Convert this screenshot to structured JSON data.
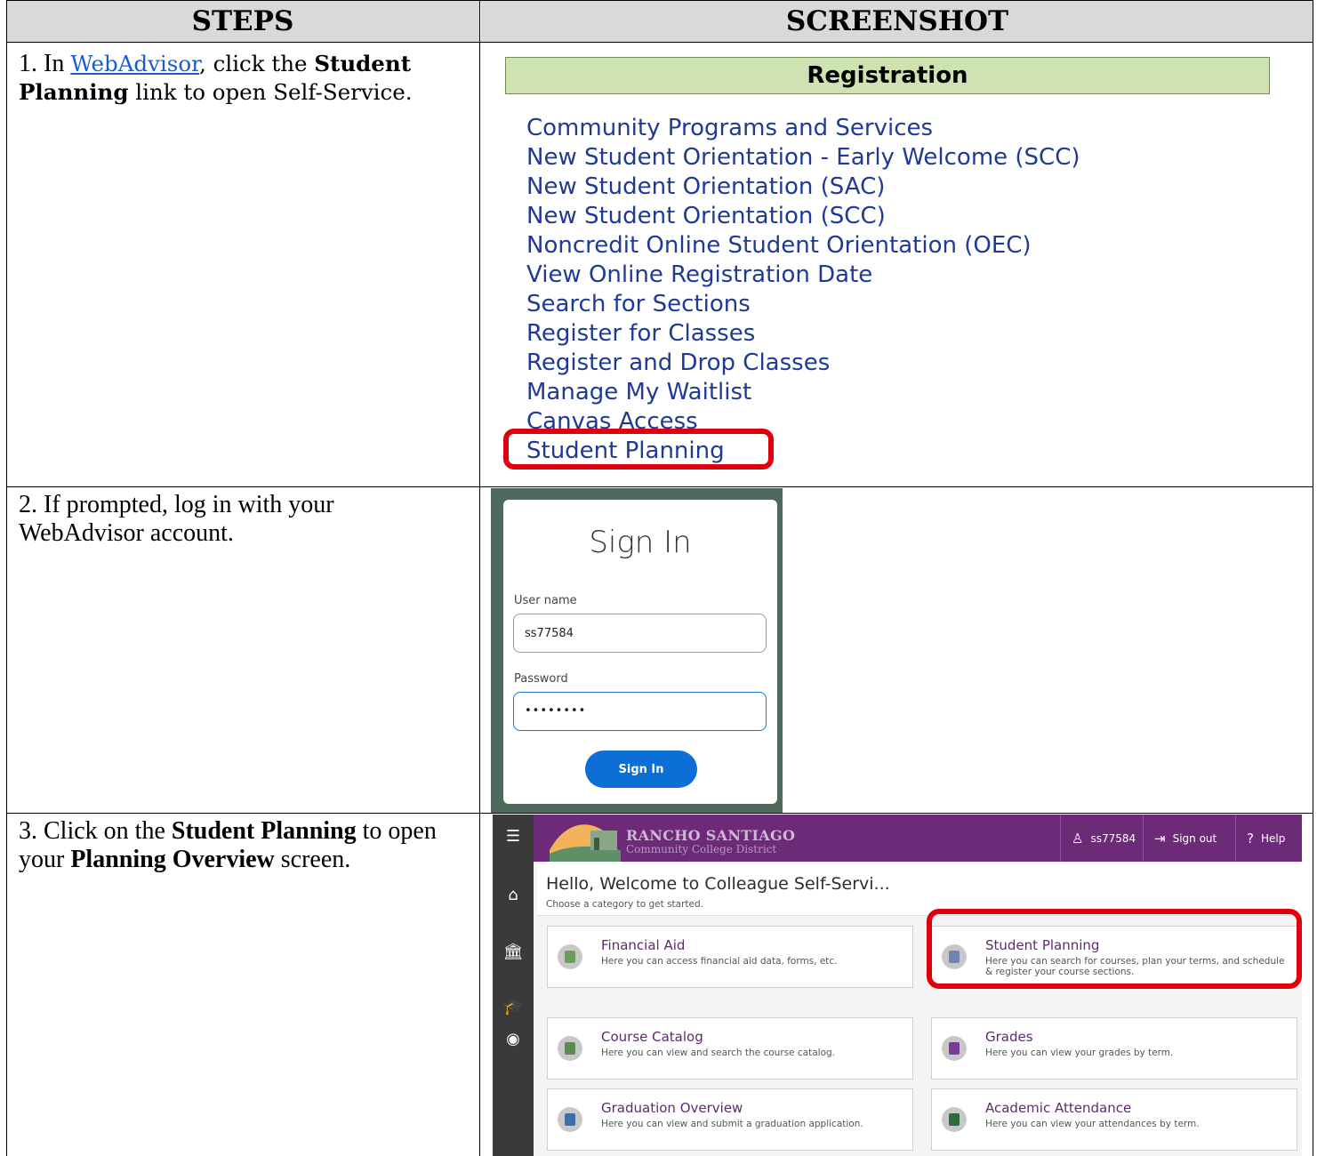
{
  "table": {
    "header_steps": "STEPS",
    "header_screenshot": "SCREENSHOT"
  },
  "steps": {
    "s1": {
      "prefix": "1.  In ",
      "link": "WebAdvisor",
      "mid": ", click the ",
      "bold": "Student Planning",
      "suffix": " link to open Self-Service."
    },
    "s2": {
      "text": "2.  If prompted, log in with your WebAdvisor account."
    },
    "s3": {
      "prefix": "3.  Click on the ",
      "bold1": "Student Planning",
      "mid": " to open your ",
      "bold2": "Planning Overview",
      "suffix": " screen."
    }
  },
  "registration": {
    "heading": "Registration",
    "items": [
      "Community Programs and Services",
      "New Student Orientation - Early Welcome (SCC)",
      "New Student Orientation (SAC)",
      "New Student Orientation (SCC)",
      "Noncredit Online Student Orientation (OEC)",
      "View Online Registration Date",
      "Search for Sections",
      "Register for Classes",
      "Register and Drop Classes",
      "Manage My Waitlist"
    ],
    "partial_item": "Canvas Access",
    "highlighted_item": "Student Planning",
    "highlight_color": "#e0000d",
    "link_color": "#1e3a96"
  },
  "signin": {
    "title": "Sign In",
    "username_label": "User name",
    "username_value": "ss77584",
    "password_label": "Password",
    "password_value": "••••••••",
    "button_label": "Sign In",
    "button_color": "#0b6fd6"
  },
  "selfservice": {
    "brand_name": "RANCHO SANTIAGO",
    "brand_sub": "Community College District",
    "user": "ss77584",
    "signout": "Sign out",
    "help": "Help",
    "welcome": "Hello, Welcome to Colleague Self-Servi...",
    "choose": "Choose a category to get started.",
    "header_color": "#6c2a78",
    "cards": [
      {
        "title": "Financial Aid",
        "desc": "Here you can access financial aid data, forms, etc.",
        "icon": "money-icon"
      },
      {
        "title": "Student Planning",
        "desc": "Here you can search for courses, plan your terms, and schedule & register your course sections.",
        "icon": "planning-icon"
      },
      {
        "title": "Course Catalog",
        "desc": "Here you can view and search the course catalog.",
        "icon": "book-icon"
      },
      {
        "title": "Grades",
        "desc": "Here you can view your grades by term.",
        "icon": "grades-icon"
      },
      {
        "title": "Graduation Overview",
        "desc": "Here you can view and submit a graduation application.",
        "icon": "graduation-icon"
      },
      {
        "title": "Academic Attendance",
        "desc": "Here you can view your attendances by term.",
        "icon": "attendance-icon"
      }
    ]
  }
}
